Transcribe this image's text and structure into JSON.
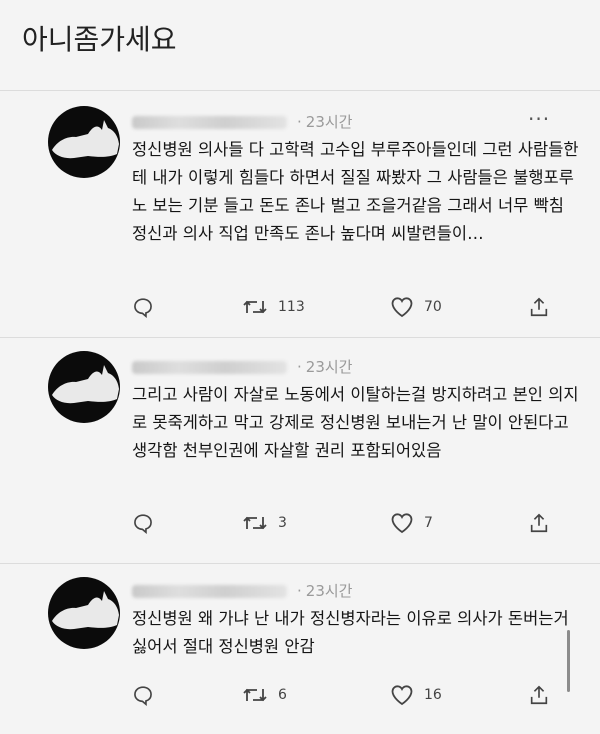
{
  "page_title": "아니좀가세요",
  "tweets": [
    {
      "time": "23시간",
      "text": "정신병원 의사들 다 고학력 고수입 부루주아들인데 그런 사람들한테 내가 이렇게 힘들다 하면서 질질 짜봤자 그 사람들은 불행포루노 보는 기분 들고 돈도 존나 벌고 조을거같음 그래서 너무 빡침 정신과 의사 직업 만족도 존나 높다며 씨발련들이…",
      "retweets": "113",
      "likes": "70"
    },
    {
      "time": "23시간",
      "text": "그리고 사람이 자살로 노동에서 이탈하는걸 방지하려고 본인 의지로 못죽게하고 막고 강제로 정신병원 보내는거 난 말이 안된다고 생각함 천부인권에 자살할 권리 포함되어있음",
      "retweets": "3",
      "likes": "7"
    },
    {
      "time": "23시간",
      "text": "정신병원 왜 가냐 난 내가 정신병자라는 이유로 의사가 돈버는거 싫어서 절대 정신병원 안감",
      "retweets": "6",
      "likes": "16"
    }
  ],
  "icons": {
    "reply": "reply-icon",
    "retweet": "retweet-icon",
    "like": "heart-icon",
    "share": "share-icon",
    "more": "more-icon"
  },
  "colors": {
    "background": "#f4f4f4",
    "text": "#151515",
    "meta": "#9a9a9a",
    "icon": "#444444"
  }
}
